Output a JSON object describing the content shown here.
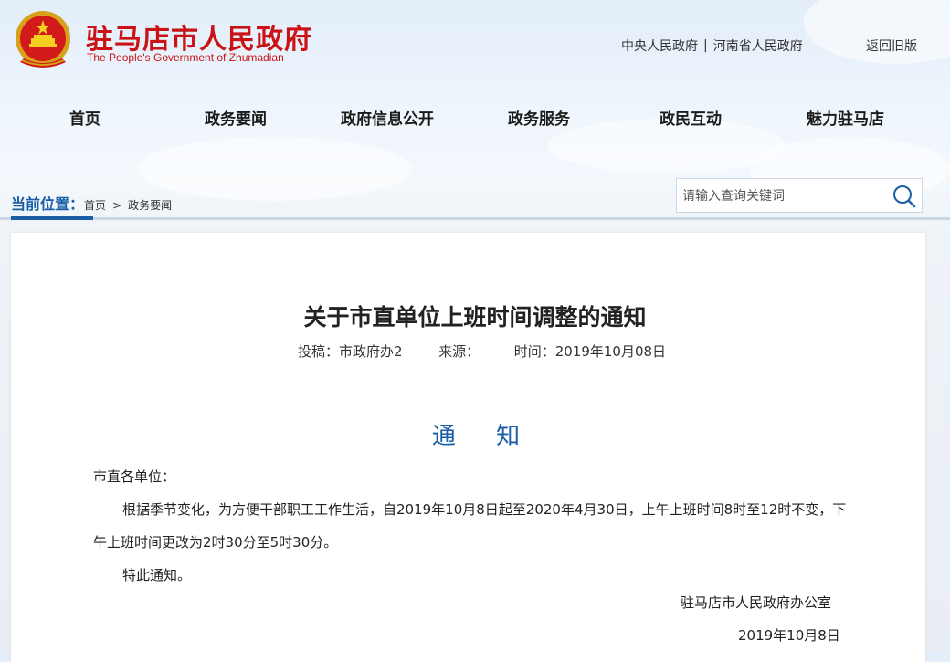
{
  "header": {
    "site_title": "驻马店市人民政府",
    "site_subtitle": "The People's Government of Zhumadian",
    "top_links": [
      "中央人民政府",
      "河南省人民政府"
    ],
    "back_old": "返回旧版"
  },
  "nav": [
    "首页",
    "政务要闻",
    "政府信息公开",
    "政务服务",
    "政民互动",
    "魅力驻马店"
  ],
  "breadcrumb": {
    "label": "当前位置：",
    "items": [
      "首页",
      "政务要闻"
    ],
    "separator": ">"
  },
  "search": {
    "placeholder": "请输入查询关键词"
  },
  "article": {
    "title": "关于市直单位上班时间调整的通知",
    "meta": {
      "author": "投稿：市政府办2",
      "source": "来源：",
      "time": "时间：2019年10月08日"
    },
    "heading": "通 知",
    "salutation": "市直各单位：",
    "paragraph1": "根据季节变化，为方便干部职工工作生活，自2019年10月8日起至2020年4月30日，上午上班时间8时至12时不变，下午上班时间更改为2时30分至5时30分。",
    "paragraph2": "特此通知。",
    "signature": "驻马店市人民政府办公室",
    "date": "2019年10月8日"
  },
  "colors": {
    "brand_red": "#c91316",
    "accent_blue": "#1a5ea6"
  },
  "icons": [
    "national-emblem-icon",
    "search-icon"
  ]
}
